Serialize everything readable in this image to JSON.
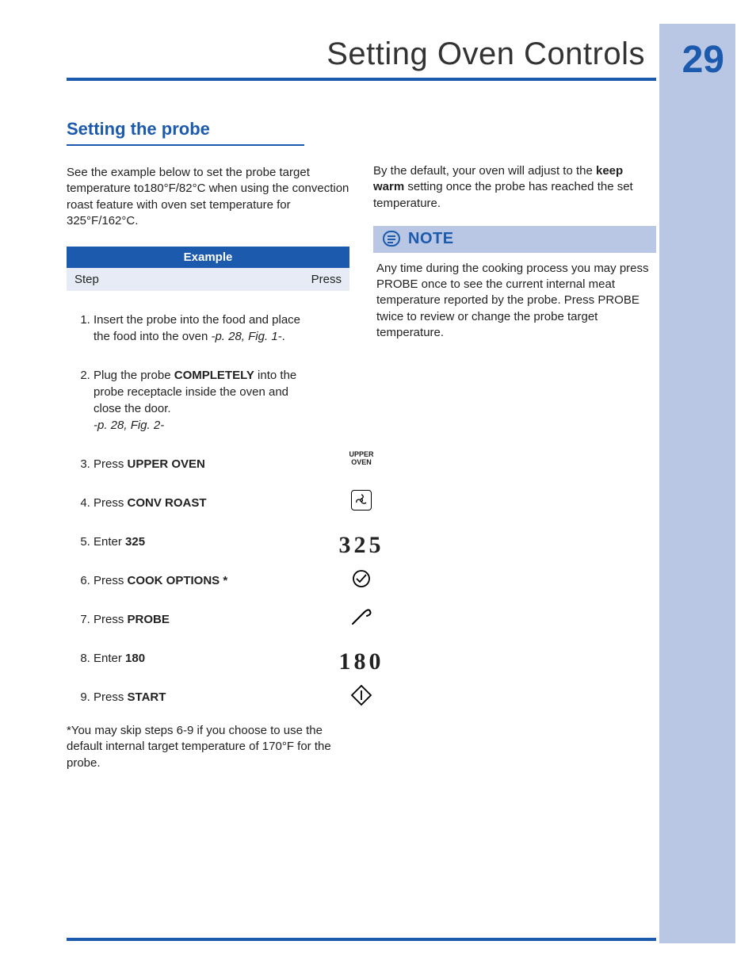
{
  "page": {
    "number": "29",
    "title": "Setting Oven Controls"
  },
  "left": {
    "heading": "Setting the probe",
    "intro": "See the example below to set the probe target temperature to180°F/82°C when using the convection roast feature with oven set temperature for 325°F/162°C.",
    "example_label": "Example",
    "step_hdr_left": "Step",
    "step_hdr_right": "Press",
    "steps": {
      "s1a": "Insert the probe into the food and place the food into the oven ",
      "s1b": "-p. 28, Fig. 1-",
      "s1c": ".",
      "s2a": "Plug the probe ",
      "s2b": "COMPLETELY",
      "s2c": " into the probe receptacle inside the oven and close the door. ",
      "s2d": "-p. 28, Fig. 2-",
      "s3a": "Press ",
      "s3b": "UPPER OVEN",
      "s4a": "Press ",
      "s4b": "CONV ROAST",
      "s5a": "Enter ",
      "s5b": "325",
      "s6a": "Press ",
      "s6b": "COOK OPTIONS *",
      "s7a": "Press ",
      "s7b": "PROBE",
      "s8a": "Enter ",
      "s8b": "180",
      "s9a": "Press ",
      "s9b": "START"
    },
    "icons": {
      "upper_oven": "UPPER\nOVEN",
      "display_325": "325",
      "display_180": "180"
    },
    "footnote": "*You may skip steps 6-9 if you choose to use the default internal target temperature of 170°F for the probe."
  },
  "right": {
    "intro_a": "By the default, your oven will adjust to the ",
    "intro_b": "keep warm",
    "intro_c": " setting once the probe has reached the set temperature.",
    "note_label": "NOTE",
    "note_body": "Any time during the cooking process you may press PROBE  once to see the current internal meat temperature reported by the probe. Press PROBE twice to review or change the probe target temperature."
  }
}
